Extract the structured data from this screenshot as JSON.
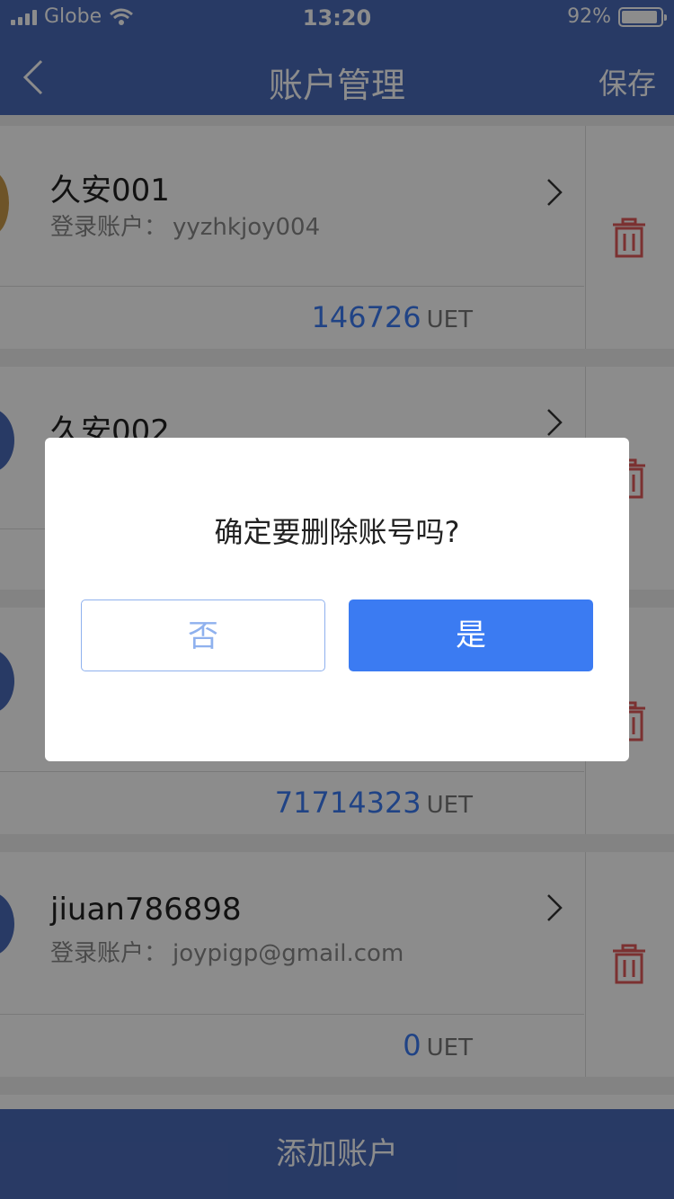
{
  "status_bar": {
    "carrier": "Globe",
    "time": "13:20",
    "battery": "92%"
  },
  "navbar": {
    "title": "账户管理",
    "save_label": "保存"
  },
  "accounts": [
    {
      "name": "久安001",
      "login_label": "登录账户：",
      "login_value": "yyzhkjoy004",
      "balance": "146726",
      "unit": "UET"
    },
    {
      "name": "久安002",
      "balance": "",
      "unit": ""
    },
    {
      "name": "",
      "balance": "71714323",
      "unit": "UET"
    },
    {
      "name": "jiuan786898",
      "login_label": "登录账户：",
      "login_value": "joypigp@gmail.com",
      "balance": "0",
      "unit": "UET"
    }
  ],
  "bottom_button": "添加账户",
  "dialog": {
    "message": "确定要删除账号吗?",
    "no_label": "否",
    "yes_label": "是"
  },
  "colors": {
    "primary": "#4a6ab8",
    "accent": "#3b7bf2",
    "danger": "#e05a5a"
  }
}
